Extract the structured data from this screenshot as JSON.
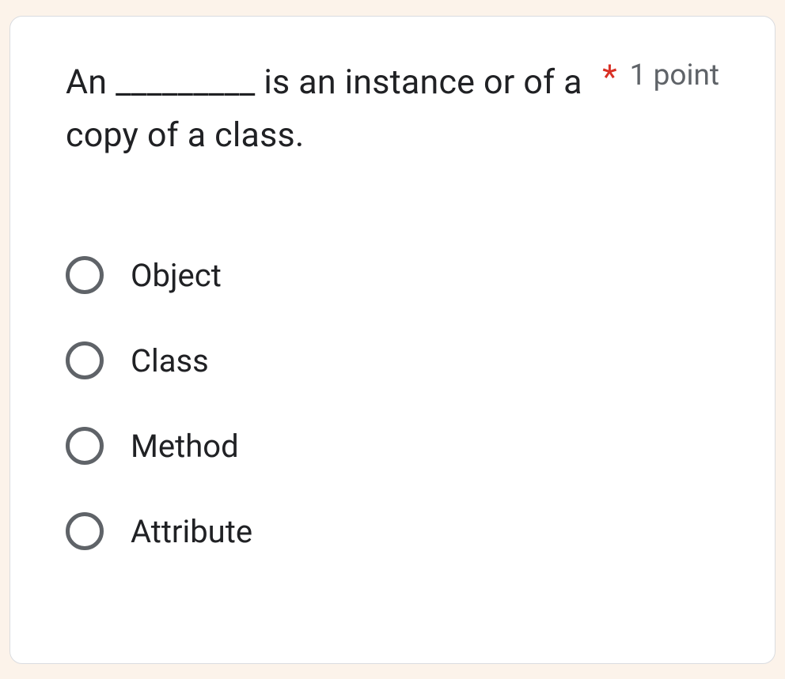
{
  "question": {
    "text": "An _________ is an instance or of a copy of a class.",
    "required_marker": "*",
    "points_label": "1 point"
  },
  "options": [
    {
      "label": "Object"
    },
    {
      "label": "Class"
    },
    {
      "label": "Method"
    },
    {
      "label": "Attribute"
    }
  ]
}
